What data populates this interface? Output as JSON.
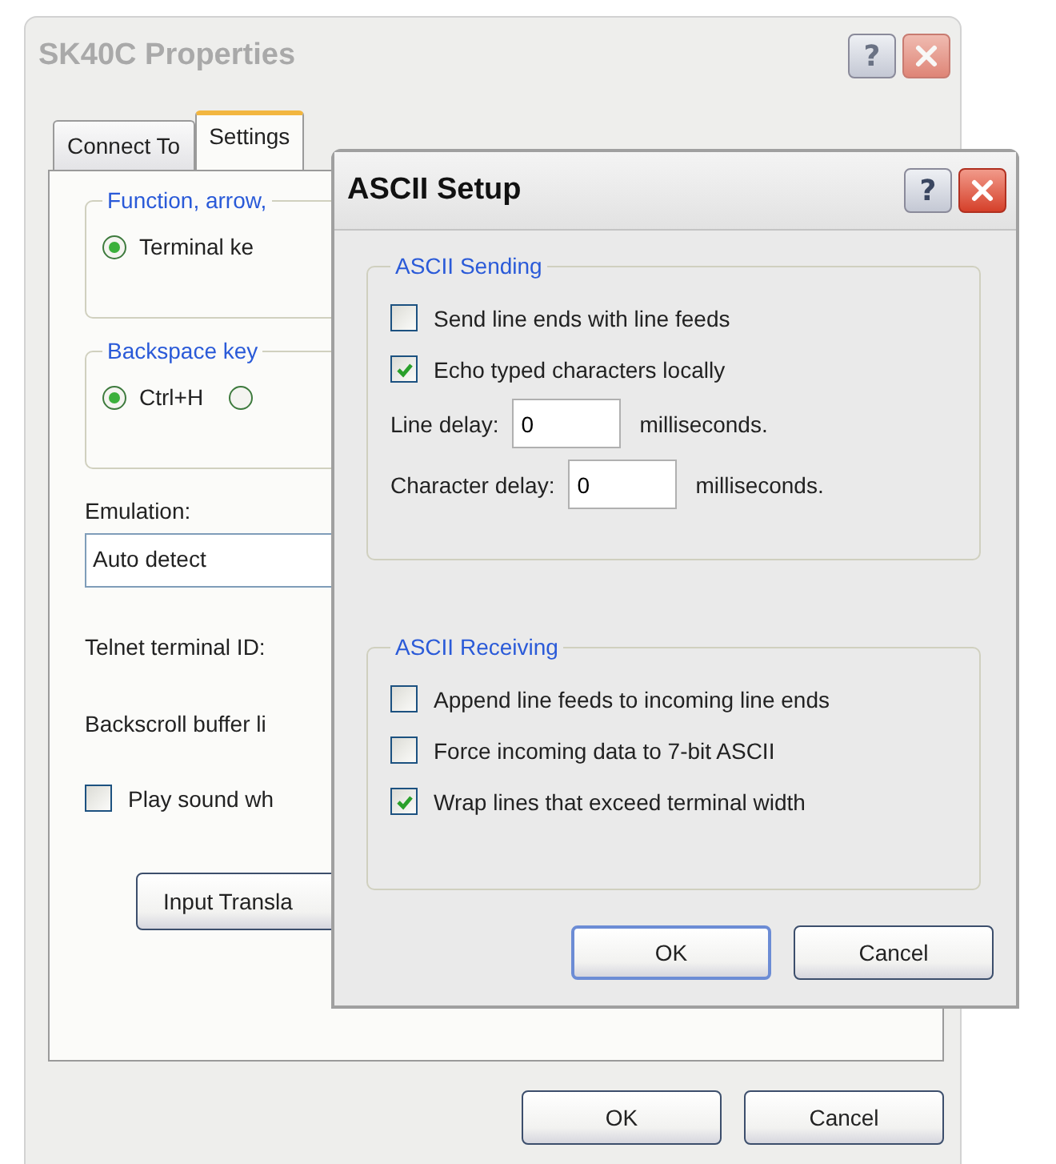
{
  "window": {
    "title": "SK40C Properties",
    "help": "?"
  },
  "tabs": [
    {
      "label": "Connect To",
      "selected": false
    },
    {
      "label": "Settings",
      "selected": true
    }
  ],
  "function_group": {
    "title": "Function, arrow,",
    "options": [
      {
        "label": "Terminal ke",
        "selected": true
      }
    ]
  },
  "backspace_group": {
    "title": "Backspace key",
    "options": [
      {
        "label": "Ctrl+H",
        "selected": true
      },
      {
        "selected": false
      }
    ]
  },
  "emulation": {
    "label": "Emulation:",
    "value": "Auto detect"
  },
  "telnet_label": "Telnet terminal ID:",
  "backscroll_label": "Backscroll buffer li",
  "play_sound": {
    "label": "Play sound wh",
    "checked": false
  },
  "input_button": "Input Transla",
  "buttons": [
    "OK",
    "Cancel"
  ],
  "dialog": {
    "title": "ASCII Setup",
    "help": "?",
    "sending": {
      "title": "ASCII Sending",
      "options": [
        {
          "label": "Send line ends with line feeds",
          "checked": false
        },
        {
          "label": "Echo typed characters locally",
          "checked": true
        }
      ],
      "delays": [
        {
          "label": "Line delay:",
          "value": "0",
          "unit": "milliseconds."
        },
        {
          "label": "Character delay:",
          "value": "0",
          "unit": "milliseconds."
        }
      ]
    },
    "receiving": {
      "title": "ASCII Receiving",
      "options": [
        {
          "label": "Append line feeds to incoming line ends",
          "checked": false
        },
        {
          "label": "Force incoming data to 7-bit ASCII",
          "checked": false
        },
        {
          "label": "Wrap lines that exceed terminal width",
          "checked": true
        }
      ]
    },
    "buttons": [
      "OK",
      "Cancel"
    ]
  }
}
